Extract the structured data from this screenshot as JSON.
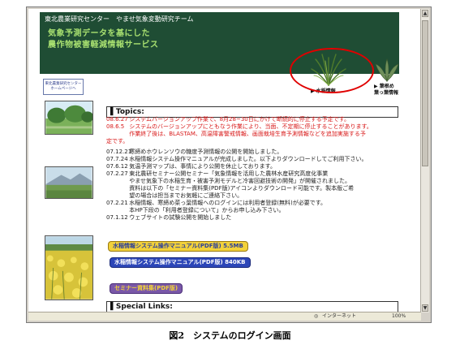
{
  "header": {
    "org": "東北農業研究センター　やませ気象変動研究チーム",
    "title_line1": "気象予測データを基にした",
    "title_line2": "農作物被害軽減情報サービス"
  },
  "logo_link": {
    "line1": "東北農業研究センター",
    "line2": "ホームページへ"
  },
  "nav": {
    "rice_label": "▶ 水稲情報",
    "veg_label_line1": "▶ 葉根め",
    "veg_label_line2": "葉っ葉情報"
  },
  "topics": {
    "heading": "▌Topics:",
    "items": [
      {
        "date": "08.6.27",
        "text": "システムバージョンアップ作業で、8月28~30日にかけて断続的に停止する予定です。",
        "red": true
      },
      {
        "date": "08.6.5",
        "text": "システムのバージョンアップにともなう作業により、当面、不定期に停止することがあります。",
        "red": true
      },
      {
        "date": "",
        "text": "作業終了後は、BLASTAM、高温障害警戒情報、画面栽培生育予測情報などを追加実施する予",
        "red": true
      },
      {
        "date": "",
        "text": "定です。",
        "red": true,
        "cont": true
      },
      {
        "date": "07.12.21",
        "text": "寒締めホウレンソウの糖度予測情報の公開を開始しました。",
        "red": false
      },
      {
        "date": "07.7.24",
        "text": "水稲情報システム操作マニュアルが完成しました。以下よりダウンロードしてご利用下さい。",
        "red": false
      },
      {
        "date": "07.6.12",
        "text": "気温予測マップは、事情により公開を休止しております。",
        "red": false
      },
      {
        "date": "07.2.27",
        "text": "東北農研セミナー公開セミナー「気象情報を活用した農林水産研究高度化事業",
        "red": false
      },
      {
        "date": "",
        "text": "やませ気象下の水稲生育・被害予測モデルと冷害回避技術の開発」が開催されました。",
        "red": false
      },
      {
        "date": "",
        "text": "資料は以下の「セミナー資料集(PDF版)アイコンよりダウンロード可能です。製本版ご希",
        "red": false
      },
      {
        "date": "",
        "text": "望の場合は担当までお気軽にご連絡下さい。",
        "red": false
      },
      {
        "date": "07.2.21",
        "text": "水稲情報、寒締め菜っ葉情報へのログインには利用者登録(無料)が必要です。",
        "red": false
      },
      {
        "date": "",
        "text": "本HP下段の「利用者登録について」からお申し込み下さい。",
        "red": false
      },
      {
        "date": "07.1.12",
        "text": "ウェブサイトの試験公開を開始しました",
        "red": false
      }
    ]
  },
  "downloads": {
    "manual_1": "水稲情報システム操作マニュアル(PDF版) 5.5MB",
    "manual_2": "水稲情報システム操作マニュアル(PDF版) 840KB",
    "seminar": "セミナー資料集(PDF版)"
  },
  "special": {
    "heading": "▌Special Links:"
  },
  "statusbar": {
    "zone": "インターネット",
    "zoom": "100%"
  },
  "caption": "図2　システムのログイン画面",
  "colors": {
    "header_bg": "#1f4d34",
    "header_title": "#a8e070",
    "alert_text": "#d81818",
    "highlight_circle": "#e00000"
  }
}
